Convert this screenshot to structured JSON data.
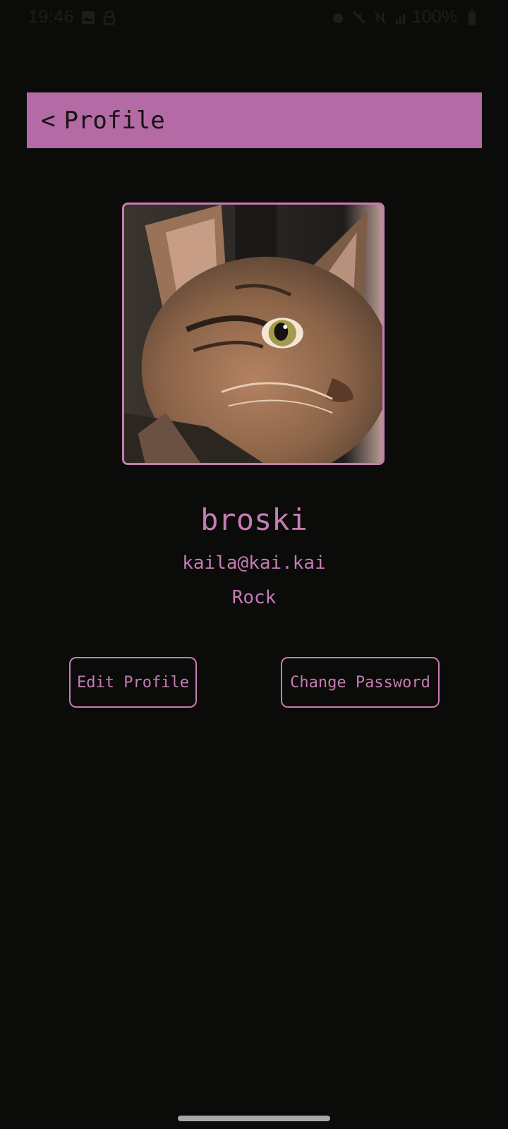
{
  "status_bar": {
    "time": "19:46",
    "battery": "100%",
    "left_icons": [
      "image-icon",
      "lock-icon"
    ],
    "right_icons": [
      "alarm-icon",
      "mute-icon",
      "data-off-icon",
      "signal-icon",
      "battery-icon"
    ]
  },
  "header": {
    "back_label": "<",
    "title": "Profile"
  },
  "profile": {
    "username": "broski",
    "email": "kaila@kai.kai",
    "genre": "Rock"
  },
  "actions": {
    "edit_label": "Edit Profile",
    "change_password_label": "Change Password"
  },
  "colors": {
    "accent": "#b46aa5",
    "text_accent": "#c77bb3",
    "background": "#0b0b09"
  }
}
